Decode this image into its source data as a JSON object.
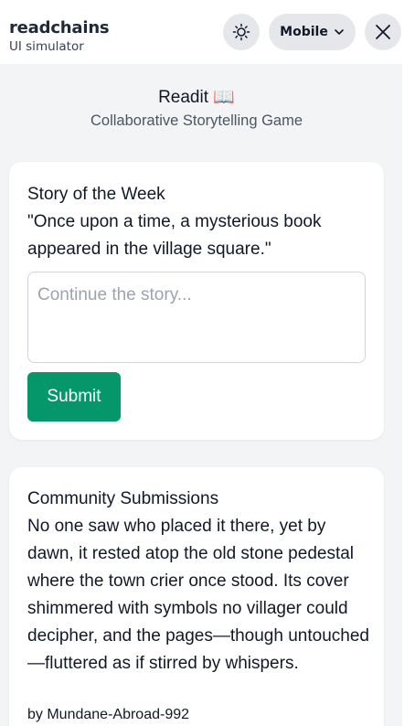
{
  "header": {
    "brand": "readchains",
    "subtitle": "UI simulator",
    "device_label": "Mobile",
    "theme_icon": "sun-icon",
    "device_icon": "chevron-down-icon",
    "close_icon": "close-icon"
  },
  "app": {
    "title": "Readit 📖",
    "subtitle": "Collaborative Storytelling Game"
  },
  "story": {
    "heading": "Story of the Week",
    "prompt": "\"Once upon a time, a mysterious book appeared in the village square.\"",
    "input_placeholder": "Continue the story...",
    "input_value": "",
    "submit_label": "Submit"
  },
  "community": {
    "heading": "Community Submissions",
    "submissions": [
      {
        "text": "No one saw who placed it there, yet by dawn, it rested atop the old stone pedestal where the town crier once stood. Its cover shimmered with symbols no villager could decipher, and the pages—though untouched—fluttered as if stirred by whispers.",
        "author": "by Mundane-Abroad-992"
      }
    ]
  },
  "colors": {
    "accent": "#059669",
    "background": "#f3f4f6",
    "card": "#ffffff",
    "pill": "#e5e7eb"
  }
}
